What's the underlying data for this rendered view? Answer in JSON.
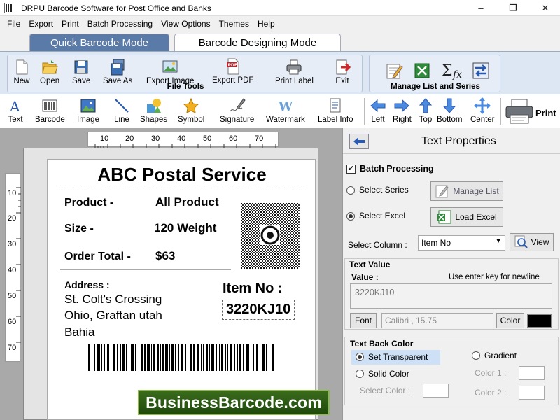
{
  "window": {
    "title": "DRPU Barcode Software for Post Office and Banks",
    "min_icon": "–",
    "max_icon": "❐",
    "close_icon": "✕"
  },
  "menu": [
    "File",
    "Export",
    "Print",
    "Batch Processing",
    "View Options",
    "Themes",
    "Help"
  ],
  "modes": {
    "quick": "Quick Barcode Mode",
    "design": "Barcode Designing Mode"
  },
  "file_tools": {
    "group_label": "File Tools",
    "buttons": [
      "New",
      "Open",
      "Save",
      "Save As",
      "Export Image",
      "Export PDF",
      "Print Label",
      "Exit"
    ]
  },
  "manage": {
    "group_label": "Manage List and Series"
  },
  "toolbar": {
    "items": [
      "Text",
      "Barcode",
      "Image",
      "Line",
      "Shapes",
      "Symbol",
      "Signature",
      "Watermark",
      "Label Info"
    ],
    "align": [
      "Left",
      "Right",
      "Top",
      "Bottom",
      "Center"
    ],
    "print": "Print"
  },
  "rulers": {
    "top": [
      "10",
      "20",
      "30",
      "40",
      "50",
      "60",
      "70"
    ],
    "left": [
      "10",
      "20",
      "30",
      "40",
      "50",
      "60",
      "70"
    ]
  },
  "label": {
    "heading": "ABC Postal Service",
    "product_key": "Product -",
    "product_val": "All Product",
    "size_key": "Size -",
    "size_val": "120 Weight",
    "order_key": "Order Total  -",
    "order_val": "$63",
    "address_key": "Address :",
    "address_lines": [
      "St. Colt's Crossing",
      "Ohio, Graftan utah",
      "Bahia"
    ],
    "item_key": "Item No :",
    "item_val": "3220KJ10"
  },
  "panel": {
    "title": "Text Properties",
    "batch": "Batch Processing",
    "select_series": "Select Series",
    "manage_list": "Manage List",
    "select_excel": "Select Excel",
    "load_excel": "Load Excel",
    "select_column": "Select Column :",
    "column_value": "Item No",
    "view": "View",
    "text_value_title": "Text Value",
    "value_label": "Value :",
    "newline_hint": "Use enter key for newline",
    "value": "3220KJ10",
    "font_btn": "Font",
    "font_value": "Calibri , 15.75",
    "color_btn": "Color",
    "text_color": "#000000",
    "back_title": "Text Back Color",
    "set_transparent": "Set Transparent",
    "gradient": "Gradient",
    "solid_color": "Solid Color",
    "color1": "Color 1 :",
    "select_color": "Select Color :",
    "color2": "Color 2 :"
  },
  "watermark": "BusinessBarcode.com",
  "colors": {
    "mode_active": "#5a7aa8",
    "ribbon_bg": "#dde6f3",
    "watermark_bg": "#2f5e15"
  }
}
